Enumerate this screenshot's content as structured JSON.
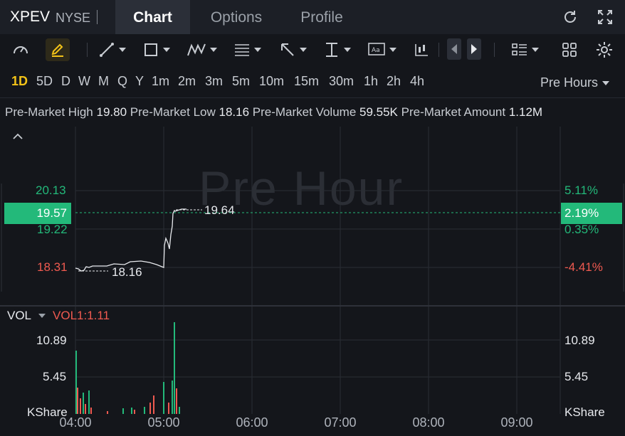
{
  "header": {
    "symbol": "XPEV",
    "exchange": "NYSE",
    "tabs": [
      {
        "label": "Chart",
        "active": true
      },
      {
        "label": "Options",
        "active": false
      },
      {
        "label": "Profile",
        "active": false
      }
    ],
    "icons": [
      "refresh-icon",
      "expand-icon"
    ]
  },
  "toolbar": {
    "tools": [
      "speedometer-icon",
      "pen-icon",
      "line-tool-icon",
      "rectangle-tool-icon",
      "pattern-tool-icon",
      "fibonacci-tool-icon",
      "arrow-tool-icon",
      "measure-tool-icon",
      "text-tool-icon",
      "candlestick-tool-icon",
      "prev-icon",
      "next-icon",
      "list-icon",
      "grid-icon",
      "settings-icon"
    ],
    "active_tool": "pen-icon"
  },
  "periods": {
    "items": [
      "1D",
      "5D",
      "D",
      "W",
      "M",
      "Q",
      "Y",
      "1m",
      "2m",
      "3m",
      "5m",
      "10m",
      "15m",
      "30m",
      "1h",
      "2h",
      "4h"
    ],
    "active": "1D",
    "session": "Pre Hours"
  },
  "stats": {
    "high_label": "Pre-Market High",
    "high_value": "19.80",
    "low_label": "Pre-Market Low",
    "low_value": "18.16",
    "volume_label": "Pre-Market Volume",
    "volume_value": "59.55K",
    "amount_label": "Pre-Market Amount",
    "amount_value": "1.12M"
  },
  "price_chart": {
    "watermark": "Pre Hour",
    "left_axis": [
      "20.13",
      "19.22",
      "18.31"
    ],
    "right_axis": [
      "5.11%",
      "0.35%",
      "-4.41%"
    ],
    "current_price": "19.57",
    "current_change": "2.19%",
    "annot_high": "19.64",
    "annot_low": "18.16"
  },
  "volume_chart": {
    "indicator": "VOL",
    "value_label": "VOL1:1.11",
    "left_axis": [
      "10.89",
      "5.45",
      "KShare"
    ],
    "right_axis": [
      "10.89",
      "5.45",
      "KShare"
    ]
  },
  "time_axis": [
    "04:00",
    "05:00",
    "06:00",
    "07:00",
    "08:00",
    "09:00"
  ],
  "colors": {
    "up": "#23b97a",
    "down": "#ef5a50",
    "accent": "#f3c318"
  }
}
